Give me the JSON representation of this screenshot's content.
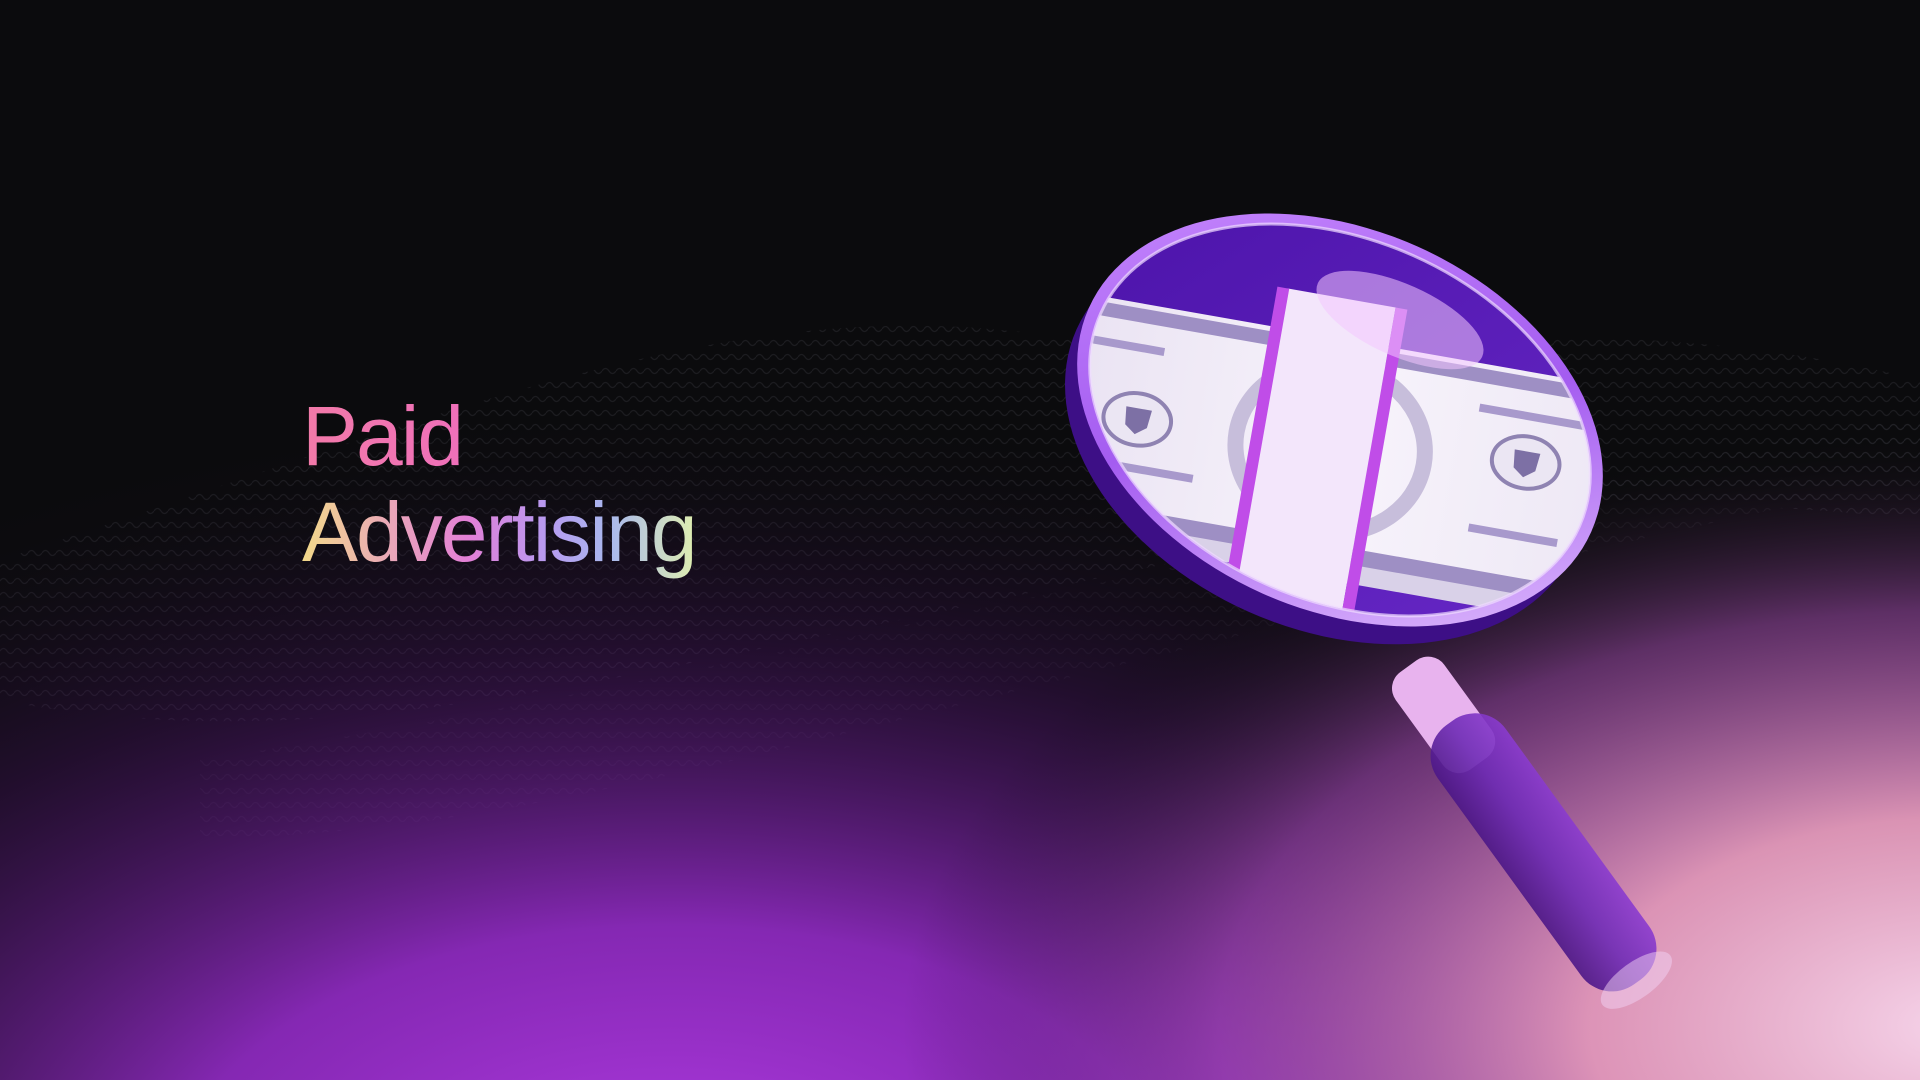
{
  "headline": {
    "line_1": "Paid",
    "line_2": "Advertising"
  },
  "colors": {
    "background": "#0b0b0d",
    "glow_purple": "#a733d9",
    "glow_pink": "#f3a7c8",
    "lens_rim": "#b56ef5",
    "handle": "#5b1f9a",
    "bill": "#f4f0f8"
  },
  "icons": [
    "magnifying-glass-icon",
    "dollar-bill-icon",
    "shield-icon"
  ]
}
